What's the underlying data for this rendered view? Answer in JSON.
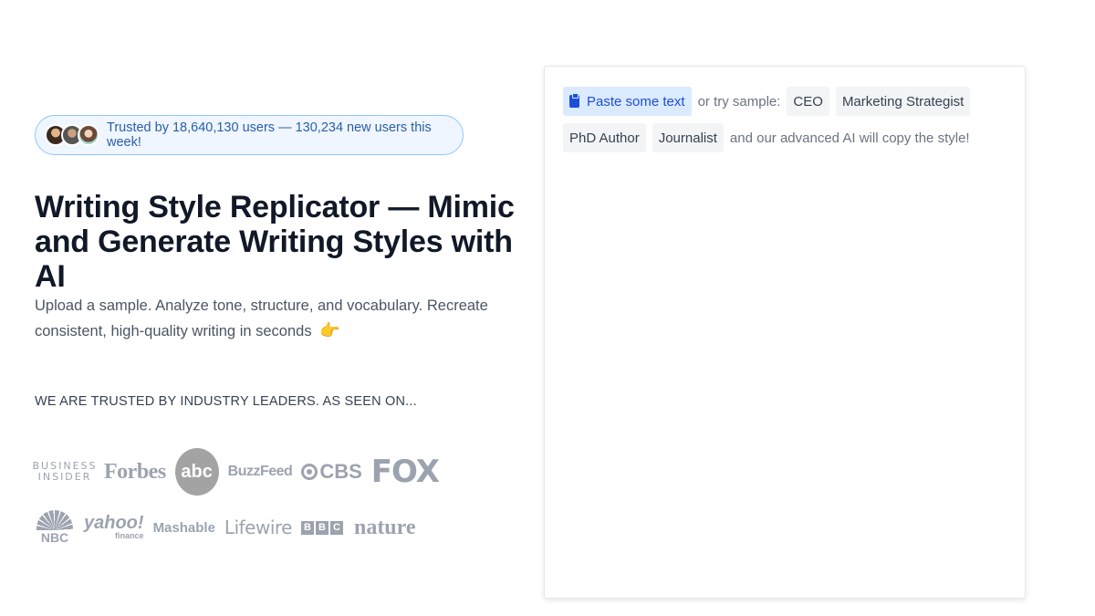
{
  "trust_banner": {
    "text": "Trusted by 18,640,130 users — 130,234 new users this week!",
    "avatars": [
      "avatar-1",
      "avatar-2",
      "avatar-3"
    ]
  },
  "hero": {
    "title": "Writing Style Replicator — Mimic and Generate Writing Styles with AI",
    "subtitle": "Upload a sample. Analyze tone, structure, and vocabulary. Recreate consistent, high-quality writing in seconds",
    "subtitle_emoji": "👉"
  },
  "trusted_section": {
    "heading": "WE ARE TRUSTED BY INDUSTRY LEADERS. AS SEEN ON...",
    "logos_row1": {
      "business_insider": [
        "BUSINESS",
        "INSIDER"
      ],
      "forbes": "Forbes",
      "abc": "abc",
      "buzzfeed": "BuzzFeed",
      "cbs": "CBS",
      "fox": "FOX"
    },
    "logos_row2": {
      "nbc": "NBC",
      "yahoo": "yahoo!",
      "yahoo_sub": "finance",
      "mashable": "Mashable",
      "lifewire": "Lifewire",
      "bbc": [
        "B",
        "B",
        "C"
      ],
      "nature": "nature"
    }
  },
  "editor_card": {
    "paste_label": "Paste some text",
    "paste_icon": "clipboard-icon",
    "try_sample_label": "or try sample:",
    "samples": [
      "CEO",
      "Marketing Strategist",
      "PhD Author",
      "Journalist"
    ],
    "trailing_text": "and our advanced AI will copy the style!"
  },
  "colors": {
    "accent_blue": "#1d4ed8",
    "pill_bg": "#eff6ff",
    "pill_border": "#93c5fd",
    "logo_gray": "#9ca3af"
  }
}
